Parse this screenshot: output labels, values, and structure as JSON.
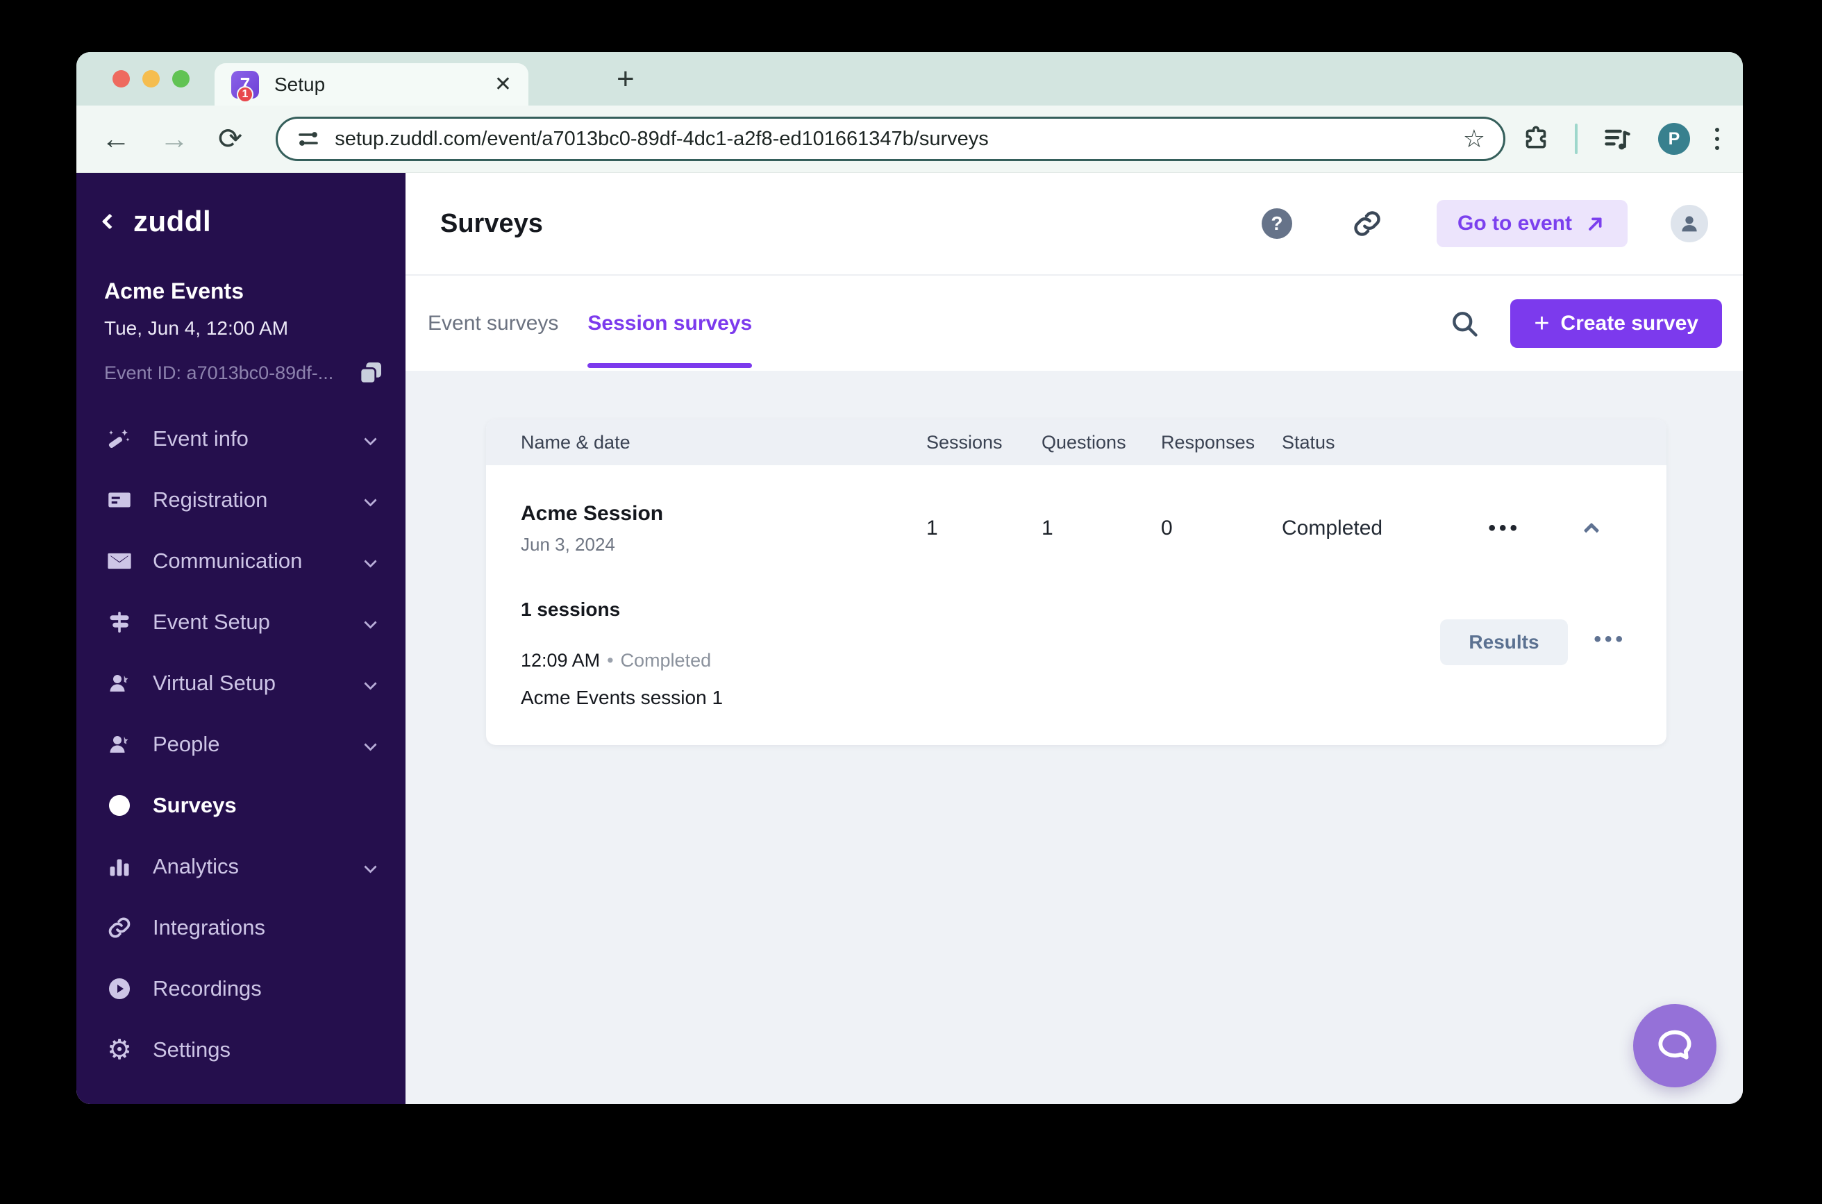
{
  "browser": {
    "tab_title": "Setup",
    "favicon_glyph": "7",
    "favicon_badge": "1",
    "url": "setup.zuddl.com/event/a7013bc0-89df-4dc1-a2f8-ed101661347b/surveys",
    "profile_initial": "P",
    "back_glyph": "←",
    "forward_glyph": "→",
    "reload_glyph": "⟳",
    "star_glyph": "☆",
    "close_glyph": "✕",
    "newtab_glyph": "+"
  },
  "sidebar": {
    "logo": "zuddl",
    "org_name": "Acme Events",
    "event_datetime": "Tue, Jun 4, 12:00 AM",
    "event_id": "Event ID: a7013bc0-89df-...",
    "items": [
      {
        "label": "Event info"
      },
      {
        "label": "Registration"
      },
      {
        "label": "Communication"
      },
      {
        "label": "Event Setup"
      },
      {
        "label": "Virtual Setup"
      },
      {
        "label": "People"
      },
      {
        "label": "Surveys"
      },
      {
        "label": "Analytics"
      },
      {
        "label": "Integrations"
      },
      {
        "label": "Recordings"
      },
      {
        "label": "Settings"
      }
    ],
    "settings_glyph": "⚙"
  },
  "header": {
    "title": "Surveys",
    "help_glyph": "?",
    "go_to_event_label": "Go to event"
  },
  "tabs": {
    "event_surveys": "Event surveys",
    "session_surveys": "Session surveys"
  },
  "actions": {
    "create_survey_label": "Create survey",
    "plus_glyph": "+"
  },
  "table": {
    "columns": [
      "Name & date",
      "Sessions",
      "Questions",
      "Responses",
      "Status"
    ],
    "row": {
      "name": "Acme Session",
      "date": "Jun 3, 2024",
      "sessions": "1",
      "questions": "1",
      "responses": "0",
      "status": "Completed",
      "menu_glyph": "•••"
    },
    "expanded": {
      "sessions_count_label": "1 sessions",
      "time": "12:09 AM",
      "separator": "•",
      "status": "Completed",
      "session_name": "Acme Events session 1",
      "results_label": "Results",
      "menu_glyph": "•••"
    }
  },
  "colors": {
    "accent_purple": "#7C3AED",
    "sidebar_bg": "#250F4D",
    "tabstrip_mint": "#D3E5E0",
    "content_bg": "#EFF2F6",
    "profile_teal": "#38808E",
    "fab_purple": "#9571D8"
  }
}
